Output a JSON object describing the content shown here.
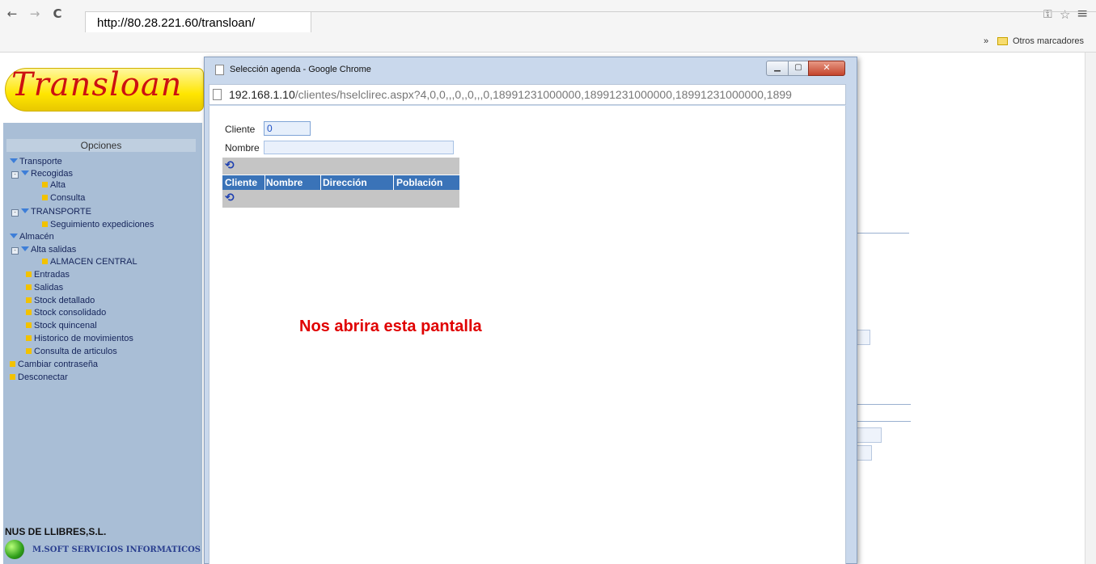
{
  "browser": {
    "back": "←",
    "forward": "→",
    "reload": "C",
    "url": "http://80.28.221.60/transloan/",
    "bookmarks_chevron": "»",
    "bookmarks_folder": "Otros marcadores"
  },
  "app": {
    "logo": "Transloan",
    "sidebar_title": "Opciones",
    "menu": [
      "Transporte",
      "Recogidas",
      "Alta",
      "Consulta",
      "TRANSPORTE",
      "Seguimiento expediciones",
      "Almacén",
      "Alta salidas",
      "ALMACEN CENTRAL",
      "Entradas",
      "Salidas",
      "Stock detallado",
      "Stock consolidado",
      "Stock quincenal",
      "Historico de movimientos",
      "Consulta de articulos",
      "Cambiar contraseña",
      "Desconectar"
    ],
    "company": "NUS DE LLIBRES,S.L.",
    "vendor": "M.SOFT SERVICIOS INFORMATICOS"
  },
  "popup": {
    "title": "Selección agenda - Google Chrome",
    "url_host": "192.168.1.10",
    "url_path": "/clientes/hselclirec.aspx?4,0,0,,,0,,0,,,0,18991231000000,18991231000000,18991231000000,1899",
    "form": {
      "cliente_label": "Cliente",
      "cliente_value": "0",
      "nombre_label": "Nombre",
      "nombre_value": ""
    },
    "grid": {
      "columns": [
        "Cliente",
        "Nombre",
        "Dirección",
        "Población"
      ]
    }
  },
  "annotation": "Nos abrira esta pantalla",
  "colors": {
    "sidebar": "#a9bed6",
    "grid_header": "#3a73b8",
    "annotation": "#e00000",
    "logo_text": "#cc1111"
  }
}
